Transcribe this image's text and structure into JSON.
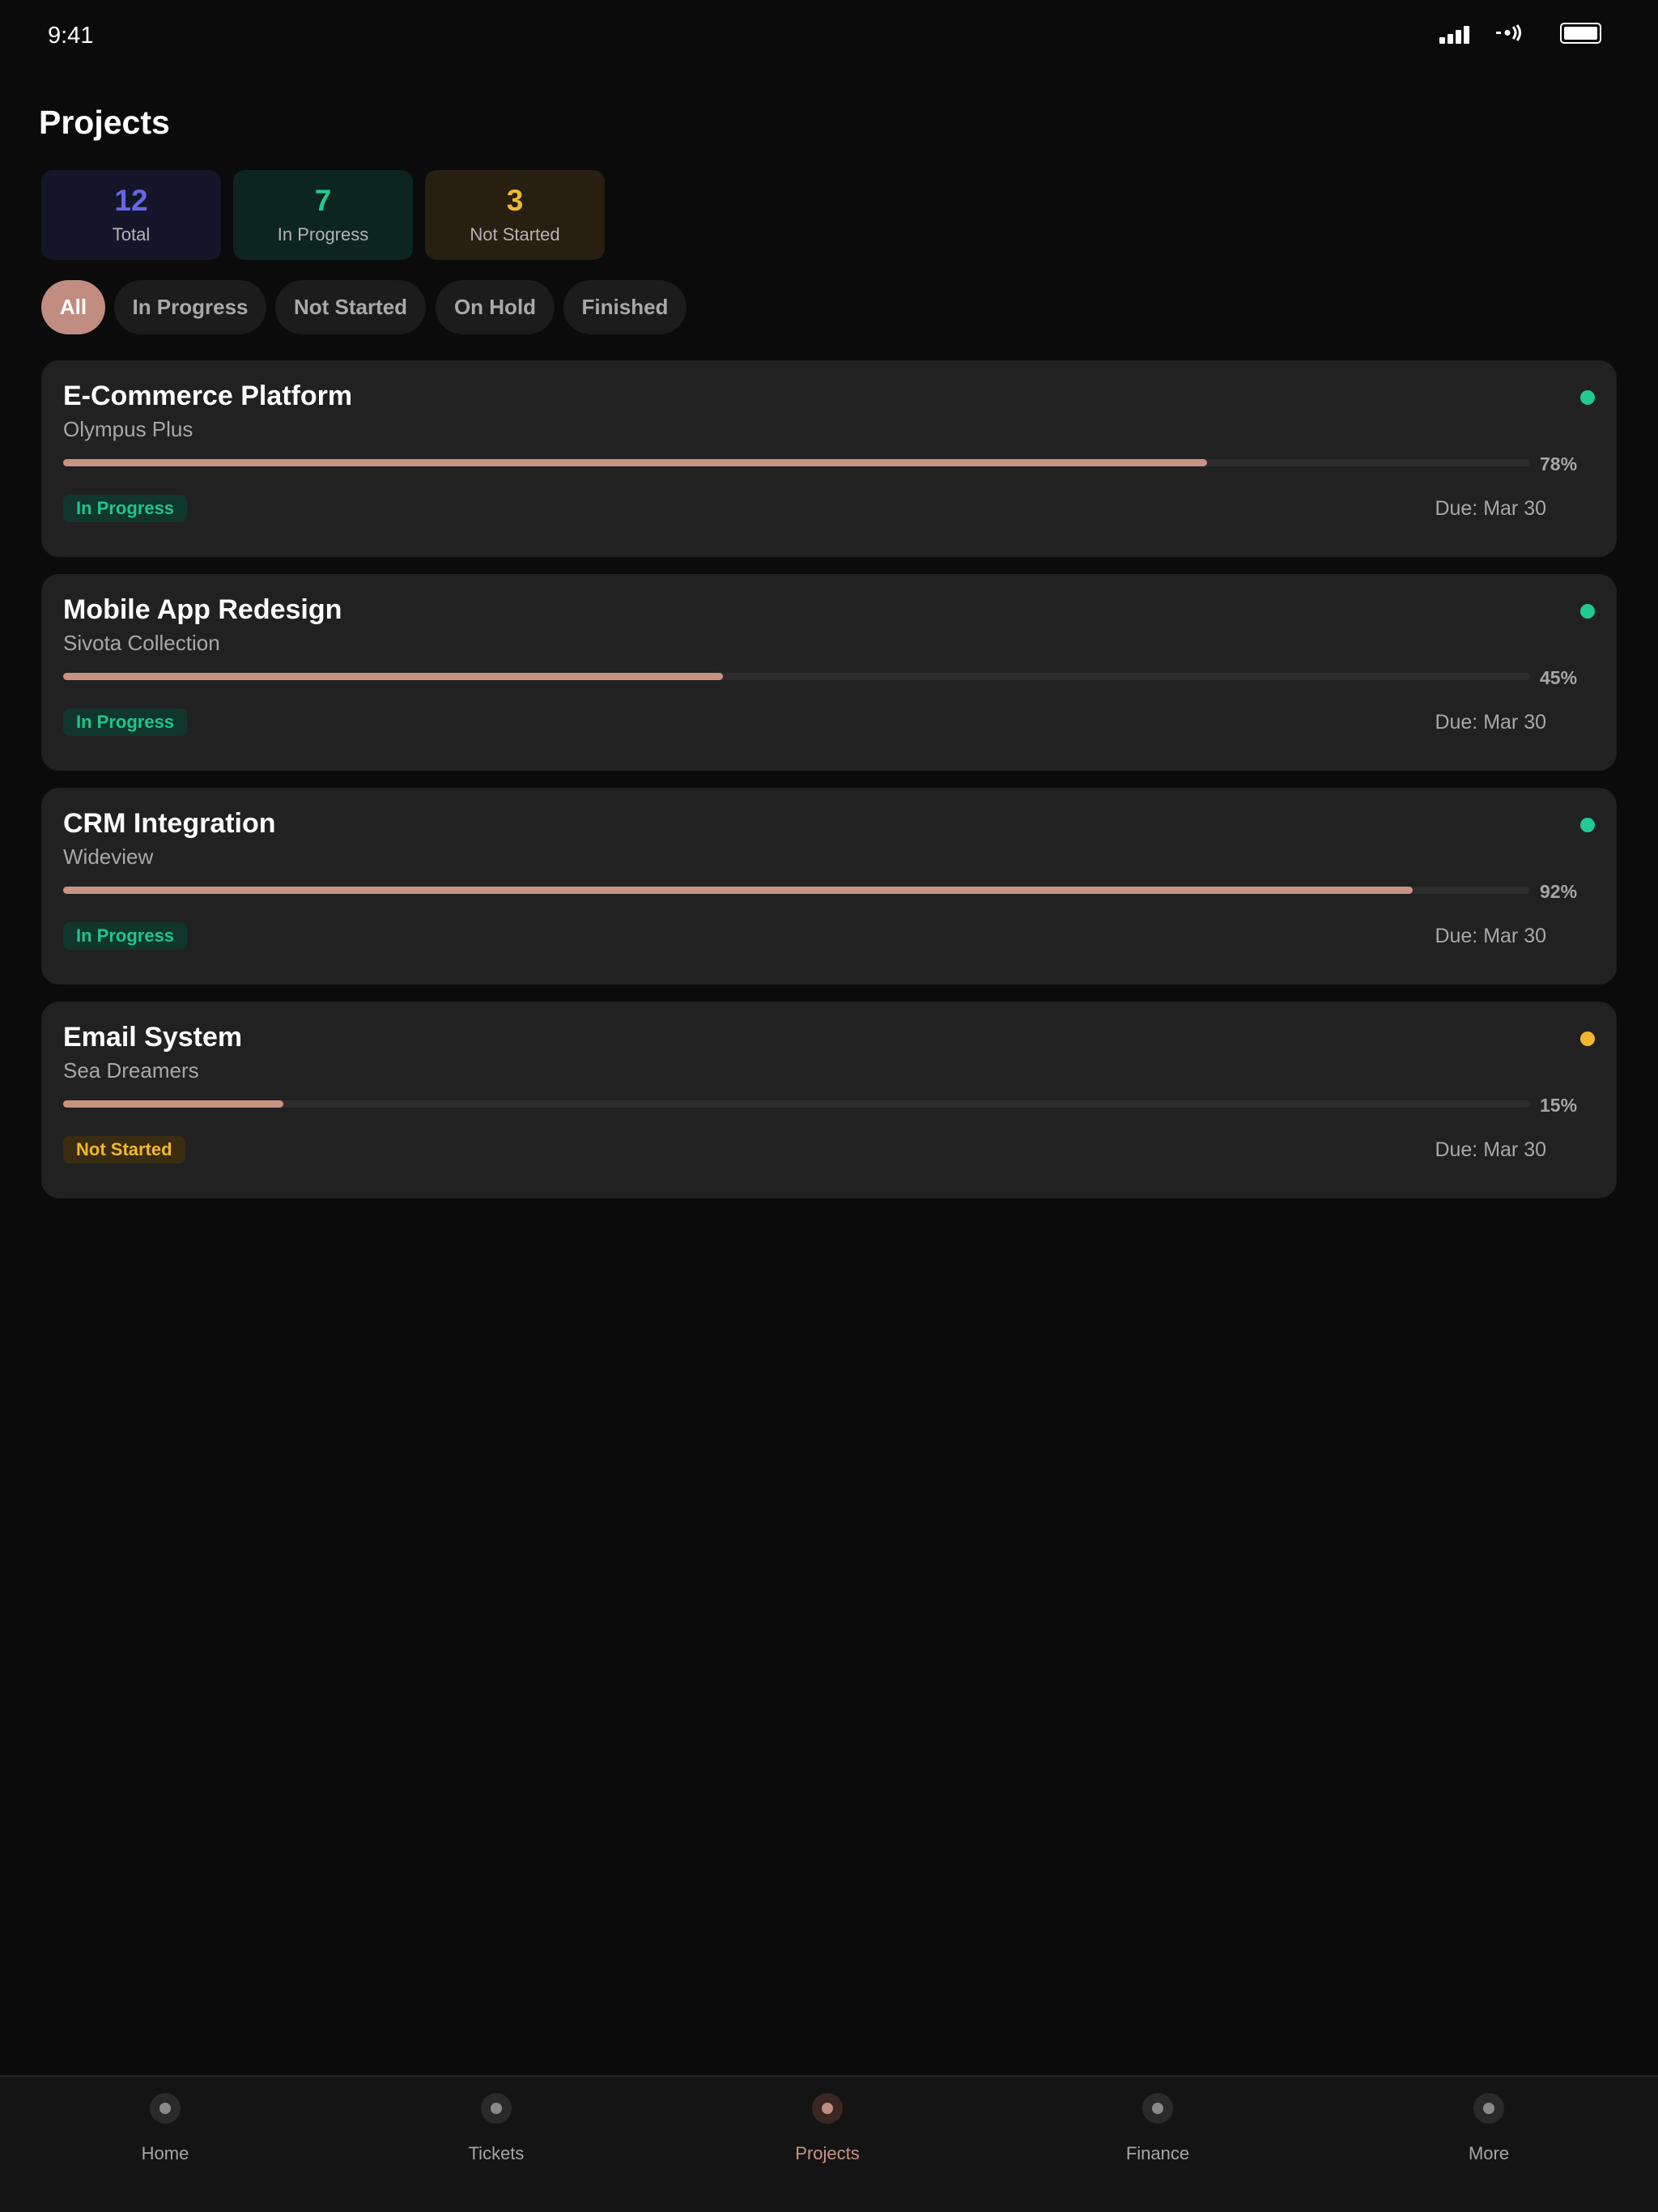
{
  "status_bar": {
    "time": "9:41"
  },
  "page": {
    "title": "Projects"
  },
  "stats": [
    {
      "value": "12",
      "label": "Total",
      "color": "#6666e6"
    },
    {
      "value": "7",
      "label": "In Progress",
      "color": "#22c993"
    },
    {
      "value": "3",
      "label": "Not Started",
      "color": "#f0b72f"
    }
  ],
  "filters": [
    {
      "label": "All",
      "active": true
    },
    {
      "label": "In Progress",
      "active": false
    },
    {
      "label": "Not Started",
      "active": false
    },
    {
      "label": "On Hold",
      "active": false
    },
    {
      "label": "Finished",
      "active": false
    }
  ],
  "projects": [
    {
      "title": "E-Commerce Platform",
      "client": "Olympus Plus",
      "progress": 78,
      "progress_label": "78%",
      "status": "In Progress",
      "due": "Due: Mar 30",
      "dot_color": "#22c993"
    },
    {
      "title": "Mobile App Redesign",
      "client": "Sivota Collection",
      "progress": 45,
      "progress_label": "45%",
      "status": "In Progress",
      "due": "Due: Mar 30",
      "dot_color": "#22c993"
    },
    {
      "title": "CRM Integration",
      "client": "Wideview",
      "progress": 92,
      "progress_label": "92%",
      "status": "In Progress",
      "due": "Due: Mar 30",
      "dot_color": "#22c993"
    },
    {
      "title": "Email System",
      "client": "Sea Dreamers",
      "progress": 15,
      "progress_label": "15%",
      "status": "Not Started",
      "due": "Due: Mar 30",
      "dot_color": "#f0b72f"
    }
  ],
  "tabs": [
    {
      "label": "Home",
      "icon": "home-icon",
      "active": false
    },
    {
      "label": "Tickets",
      "icon": "tickets-icon",
      "active": false
    },
    {
      "label": "Projects",
      "icon": "projects-icon",
      "active": true
    },
    {
      "label": "Finance",
      "icon": "finance-icon",
      "active": false
    },
    {
      "label": "More",
      "icon": "more-icon",
      "active": false
    }
  ],
  "colors": {
    "accent": "#c08d80",
    "background": "#0b0b0b",
    "card": "#212121"
  }
}
